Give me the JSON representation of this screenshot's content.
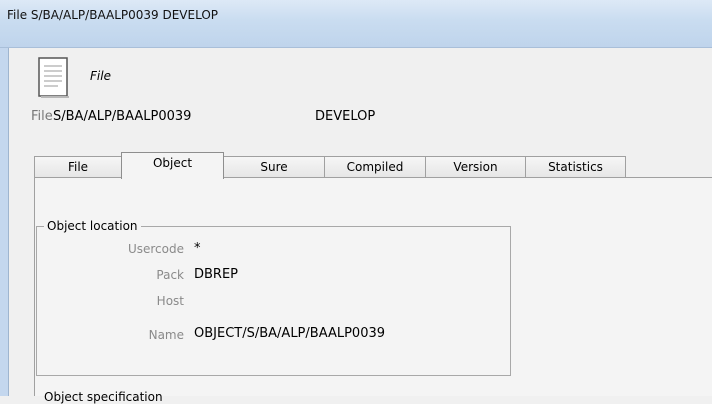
{
  "window": {
    "title": "File S/BA/ALP/BAALP0039 DEVELOP"
  },
  "header": {
    "icon": "document-icon",
    "caption": "File",
    "file_label": "File",
    "file_path": "S/BA/ALP/BAALP0039",
    "system": "DEVELOP"
  },
  "tabs": [
    {
      "label": "File"
    },
    {
      "label": "Object"
    },
    {
      "label": "Sure"
    },
    {
      "label": "Compiled"
    },
    {
      "label": "Version"
    },
    {
      "label": "Statistics"
    }
  ],
  "active_tab": "Object",
  "object_location": {
    "caption": "Object location",
    "usercode": {
      "label": "Usercode",
      "value": "*"
    },
    "pack": {
      "label": "Pack",
      "value": "DBREP"
    },
    "host": {
      "label": "Host",
      "value": ""
    },
    "name": {
      "label": "Name",
      "value": "OBJECT/S/BA/ALP/BAALP0039"
    }
  },
  "object_specification": {
    "caption": "Object specification"
  }
}
